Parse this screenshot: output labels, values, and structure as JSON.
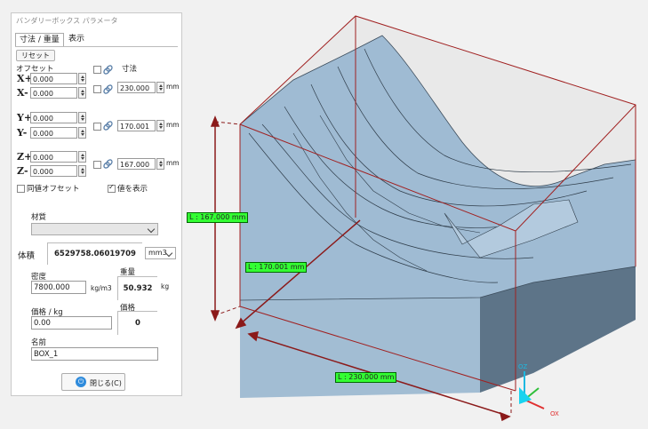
{
  "dialog": {
    "title": "バンダリーボックス パラメータ",
    "tabs": [
      {
        "label": "寸法 / 重量"
      },
      {
        "label": "表示"
      }
    ],
    "reset_label": "リセット",
    "offset_label": "オフセット",
    "dimension_label": "寸法",
    "axes": {
      "xp": {
        "label": "X+",
        "value": "0.000"
      },
      "xm": {
        "label": "X-",
        "value": "0.000"
      },
      "yp": {
        "label": "Y+",
        "value": "0.000"
      },
      "ym": {
        "label": "Y-",
        "value": "0.000"
      },
      "zp": {
        "label": "Z+",
        "value": "0.000"
      },
      "zm": {
        "label": "Z-",
        "value": "0.000"
      }
    },
    "dims": {
      "x": {
        "value": "230.000",
        "unit": "mm"
      },
      "y": {
        "value": "170.001",
        "unit": "mm"
      },
      "z": {
        "value": "167.000",
        "unit": "mm"
      }
    },
    "same_offset_label": "同値オフセット",
    "show_values_label": "値を表示",
    "show_values_checked": true,
    "material_label": "材質",
    "material_value": "",
    "volume_label": "体積",
    "volume_value": "6529758.06019709",
    "volume_unit": "mm3",
    "density_label": "密度",
    "density_value": "7800.000",
    "density_unit": "kg/m3",
    "weight_label": "重量",
    "weight_value": "50.932",
    "weight_unit": "kg",
    "unit_price_label": "価格 / kg",
    "unit_price_value": "0.00",
    "price_label": "価格",
    "price_value": "0",
    "name_label": "名前",
    "name_value": "BOX_1",
    "close_label": "閉じる(C)"
  },
  "viewport": {
    "dim_labels": {
      "z": "L : 167.000 mm",
      "y": "L : 170.001 mm",
      "x": "L : 230.000 mm"
    },
    "triad": {
      "z": "OZ",
      "x": "OX"
    },
    "colors": {
      "model": "#a4bfd6",
      "box_lines": "#a02020",
      "dim_label_bg": "#33ff33"
    }
  }
}
